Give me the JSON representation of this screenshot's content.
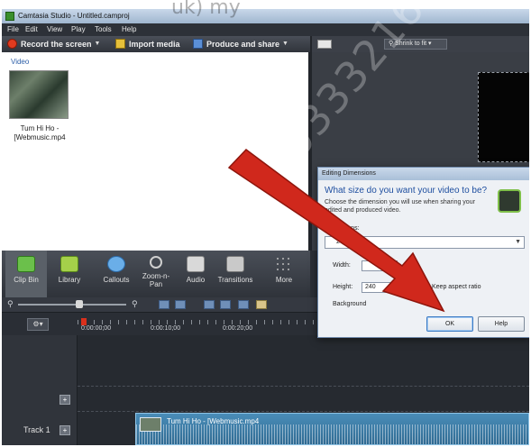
{
  "window": {
    "title": "Camtasia Studio - Untitled.camproj"
  },
  "menu": [
    "File",
    "Edit",
    "View",
    "Play",
    "Tools",
    "Help"
  ],
  "toolbar": {
    "record_label": "Record the screen",
    "import_label": "Import media",
    "produce_label": "Produce and share"
  },
  "preview": {
    "zoom_label": "Shrink to fit"
  },
  "clip_bin": {
    "section_label": "Video",
    "item_caption_line1": "Tum Hi Ho -",
    "item_caption_line2": "[Webmusic.mp4"
  },
  "tabs": [
    {
      "label": "Clip Bin",
      "active": true
    },
    {
      "label": "Library"
    },
    {
      "label": "Callouts"
    },
    {
      "label": "Zoom-n-",
      "label2": "Pan"
    },
    {
      "label": "Audio"
    },
    {
      "label": "Transitions"
    },
    {
      "label": "More"
    }
  ],
  "timeline": {
    "time_labels": [
      "0:00:00;00",
      "0:00:10;00",
      "0:00:20;00"
    ],
    "track_label": "Track 1",
    "clip_label": "Tum Hi Ho - [Webmusic.mp4"
  },
  "dialog": {
    "title": "Editing Dimensions",
    "heading": "What size do you want your video to be?",
    "description": "Choose the dimension you will use when sharing your edited and produced video.",
    "dimensions_label": "Dimensions:",
    "dimensions_value": "240",
    "width_label": "Width:",
    "height_label": "Height:",
    "height_value": "240",
    "keep_aspect_label": "Keep aspect ratio",
    "keep_aspect_checked": true,
    "background_label": "Background",
    "ok_label": "OK",
    "help_label": "Help"
  },
  "watermark": {
    "text": "0333216",
    "top_text": "uk) my"
  },
  "colors": {
    "accent_arrow": "#d0281c",
    "dialog_heading": "#1f4fa0"
  }
}
